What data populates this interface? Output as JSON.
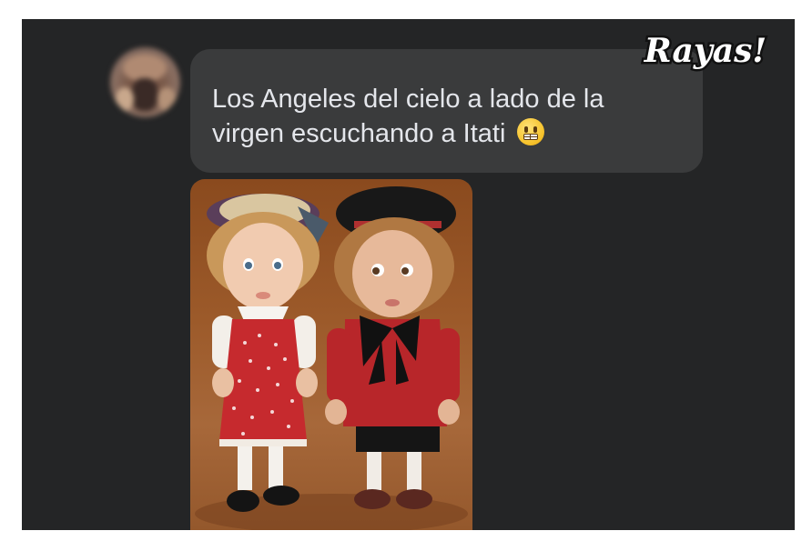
{
  "message": {
    "text": "Los Angeles del cielo a lado de la virgen escuchando a Itati",
    "emoji": "grimacing-face-emoji"
  },
  "avatar": {
    "icon": "profile-avatar"
  },
  "photo": {
    "icon": "dolls-photo"
  },
  "watermark": {
    "text": "Rayas!"
  },
  "colors": {
    "chat_background": "#242526",
    "bubble_background": "#3a3b3c",
    "bubble_text": "#e4e6eb",
    "page_background": "#ffffff"
  }
}
